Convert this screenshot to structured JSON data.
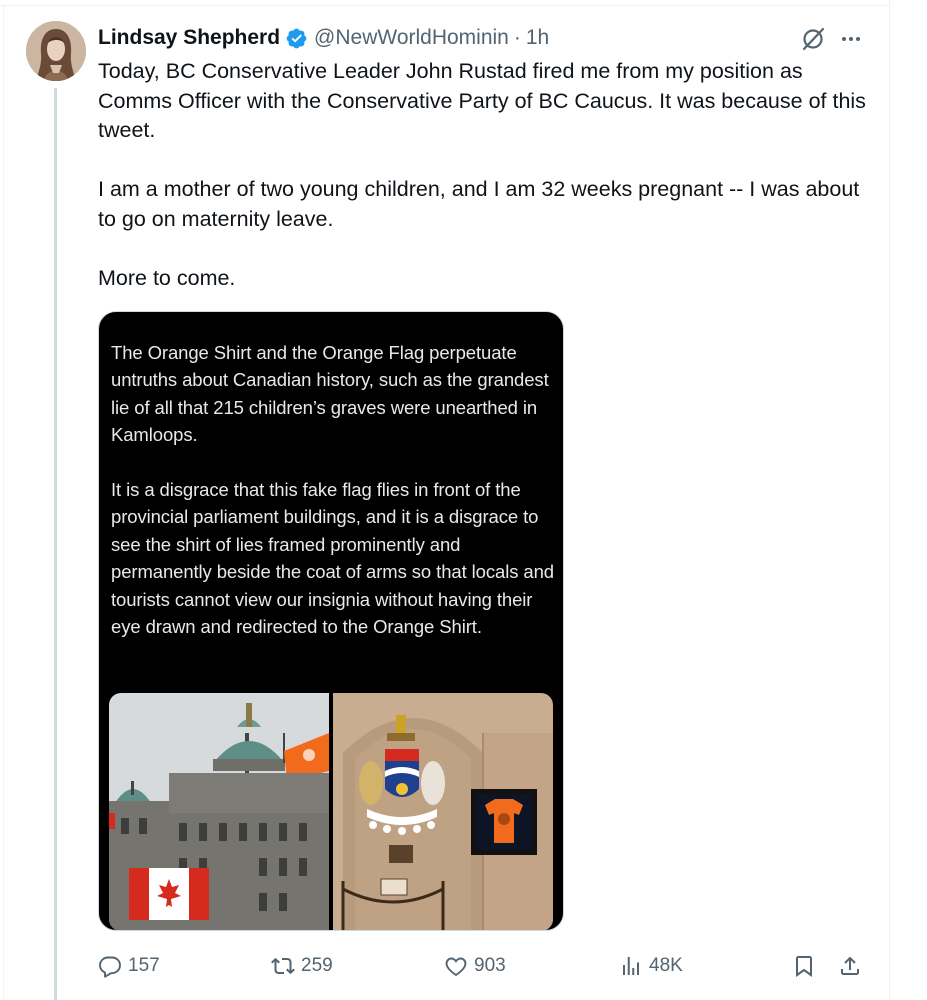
{
  "author": {
    "name": "Lindsay Shepherd",
    "handle": "@NewWorldHominin",
    "separator": "·",
    "time": "1h"
  },
  "tweet": {
    "paragraphs": [
      "Today, BC Conservative Leader John Rustad fired me from my position as Comms Officer with the Conservative Party of BC Caucus. It was because of this tweet.",
      "I am a mother of two young children, and I am 32 weeks pregnant -- I was about to go on maternity leave.",
      "More to come."
    ]
  },
  "media": {
    "screenshot_paragraphs": [
      "The Orange Shirt and the Orange Flag perpetuate untruths about Canadian history, such as the grandest lie of all that 215 children’s graves were unearthed in Kamloops.",
      "It is a disgrace that this fake flag flies in front of the provincial parliament buildings, and it is a disgrace to see the shirt of lies framed prominently and permanently beside the coat of arms so that locals and tourists cannot view our insignia without having their eye drawn and redirected to the Orange Shirt."
    ]
  },
  "actions": {
    "replies": "157",
    "reposts": "259",
    "likes": "903",
    "views": "48K"
  },
  "icons": {
    "verified": "verified-badge-icon",
    "grok": "grok-icon",
    "more": "more-icon",
    "reply": "reply-icon",
    "repost": "repost-icon",
    "like": "like-icon",
    "views": "views-icon",
    "bookmark": "bookmark-icon",
    "share": "share-icon"
  },
  "colors": {
    "verified_blue": "#1d9bf0",
    "text": "#0f1419",
    "secondary": "#536471",
    "orange": "#f26b1d"
  }
}
